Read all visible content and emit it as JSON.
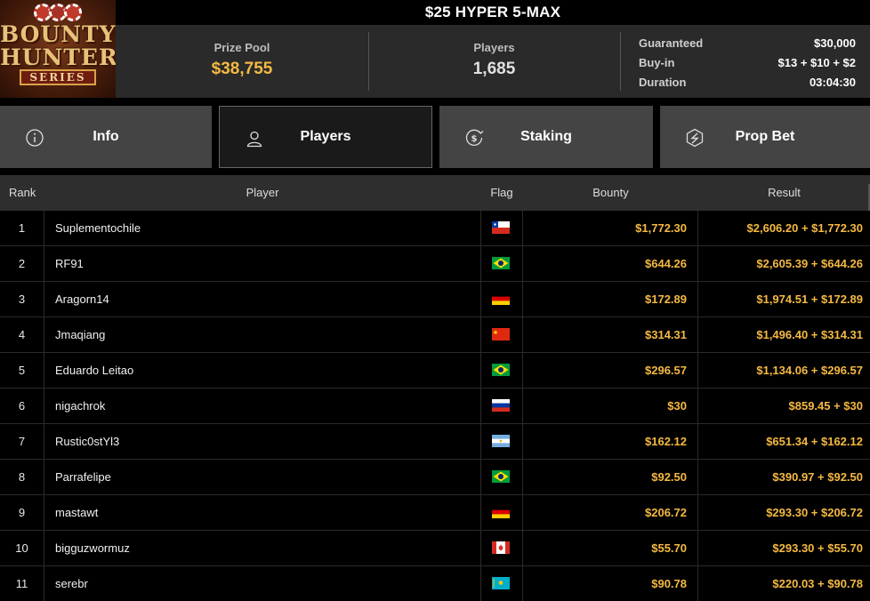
{
  "logo": {
    "line1": "BOUNTY",
    "line2": "HUNTERS",
    "line3": "SERIES"
  },
  "title": "$25 HYPER 5-MAX",
  "stats": {
    "prize_pool_label": "Prize Pool",
    "prize_pool_value": "$38,755",
    "players_label": "Players",
    "players_value": "1,685"
  },
  "details": [
    {
      "label": "Guaranteed",
      "value": "$30,000"
    },
    {
      "label": "Buy-in",
      "value": "$13 + $10 + $2"
    },
    {
      "label": "Duration",
      "value": "03:04:30"
    }
  ],
  "tabs": [
    {
      "label": "Info",
      "icon": "info-icon"
    },
    {
      "label": "Players",
      "icon": "user-icon",
      "active": true
    },
    {
      "label": "Staking",
      "icon": "dollar-coin-icon"
    },
    {
      "label": "Prop Bet",
      "icon": "hexagon-bolt-icon"
    }
  ],
  "table": {
    "headers": {
      "rank": "Rank",
      "player": "Player",
      "flag": "Flag",
      "bounty": "Bounty",
      "result": "Result"
    },
    "rows": [
      {
        "rank": "1",
        "player": "Suplementochile",
        "flag": "chile",
        "bounty": "$1,772.30",
        "result": "$2,606.20 + $1,772.30"
      },
      {
        "rank": "2",
        "player": "RF91",
        "flag": "brazil",
        "bounty": "$644.26",
        "result": "$2,605.39 + $644.26"
      },
      {
        "rank": "3",
        "player": "Aragorn14",
        "flag": "germany",
        "bounty": "$172.89",
        "result": "$1,974.51 + $172.89"
      },
      {
        "rank": "4",
        "player": "Jmaqiang",
        "flag": "china",
        "bounty": "$314.31",
        "result": "$1,496.40 + $314.31"
      },
      {
        "rank": "5",
        "player": "Eduardo Leitao",
        "flag": "brazil",
        "bounty": "$296.57",
        "result": "$1,134.06 + $296.57"
      },
      {
        "rank": "6",
        "player": "nigachrok",
        "flag": "russia",
        "bounty": "$30",
        "result": "$859.45 + $30"
      },
      {
        "rank": "7",
        "player": "Rustic0stYl3",
        "flag": "argentina",
        "bounty": "$162.12",
        "result": "$651.34 + $162.12"
      },
      {
        "rank": "8",
        "player": "Parrafelipe",
        "flag": "brazil",
        "bounty": "$92.50",
        "result": "$390.97 + $92.50"
      },
      {
        "rank": "9",
        "player": "mastawt",
        "flag": "germany",
        "bounty": "$206.72",
        "result": "$293.30 + $206.72"
      },
      {
        "rank": "10",
        "player": "bigguzwormuz",
        "flag": "canada",
        "bounty": "$55.70",
        "result": "$293.30 + $55.70"
      },
      {
        "rank": "11",
        "player": "serebr",
        "flag": "kazakhstan",
        "bounty": "$90.78",
        "result": "$220.03 + $90.78"
      }
    ]
  },
  "colors": {
    "accent": "#f5b942",
    "panel": "#2a2a2a",
    "tab": "#444444",
    "tab_active": "#1a1a1a"
  }
}
